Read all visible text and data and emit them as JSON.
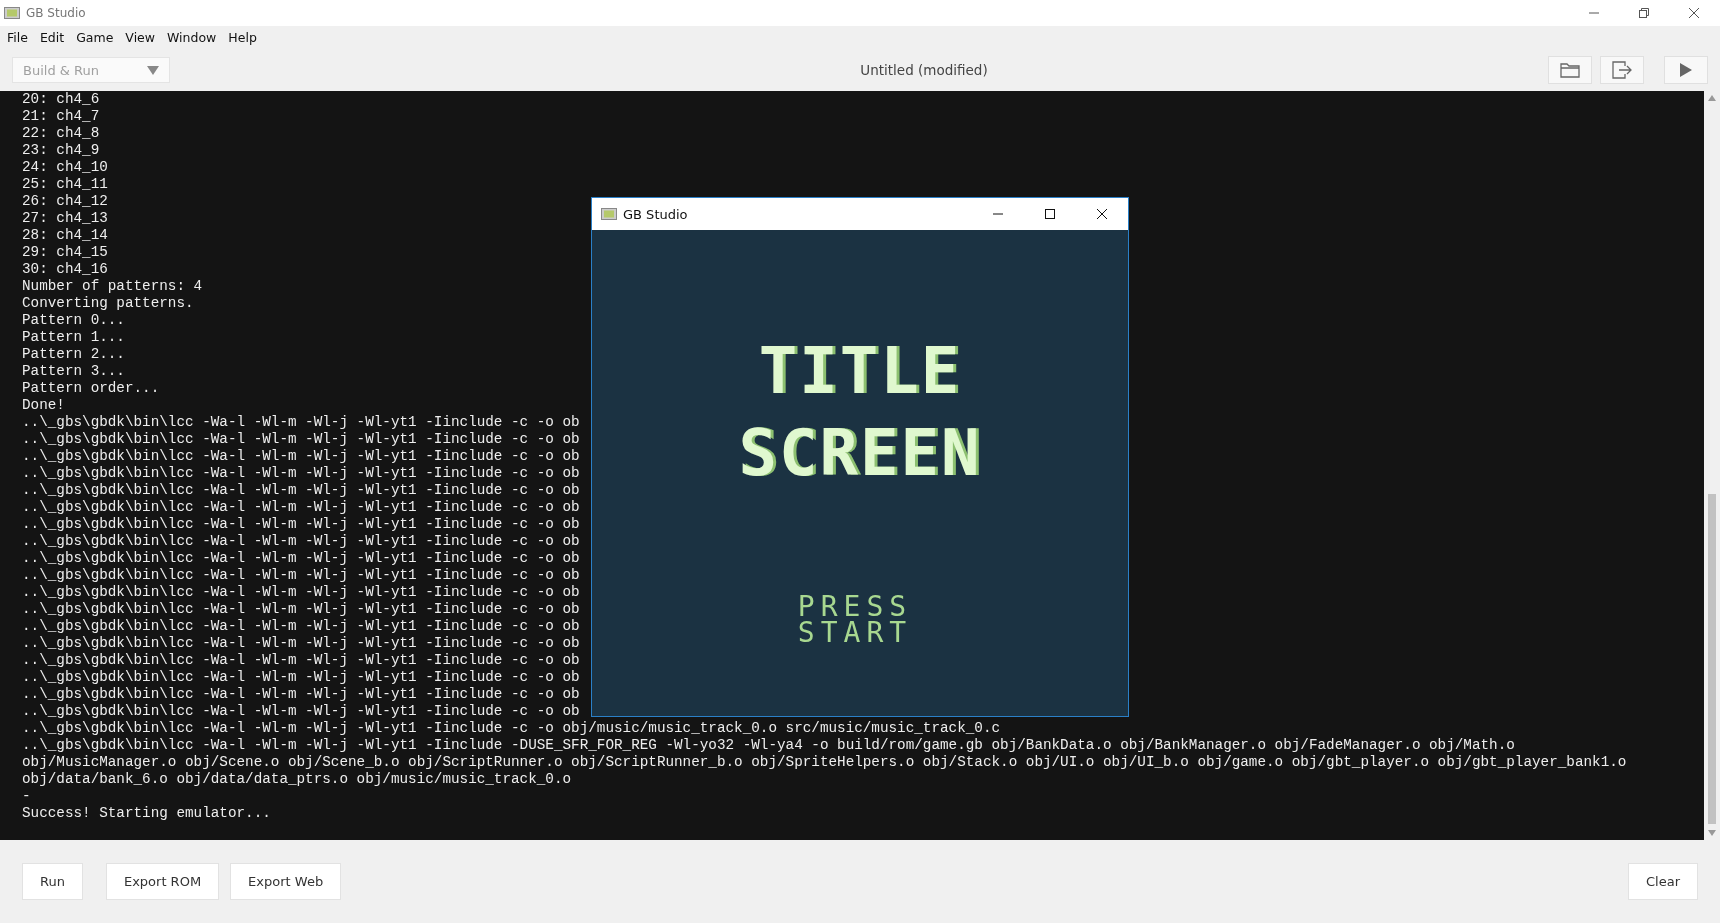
{
  "window": {
    "title": "GB Studio"
  },
  "menu": [
    "File",
    "Edit",
    "Game",
    "View",
    "Window",
    "Help"
  ],
  "toolbar": {
    "build_dropdown": {
      "label": "Build & Run",
      "disabled": true
    },
    "project_title": "Untitled (modified)"
  },
  "console": {
    "lines": [
      "20: ch4_6",
      "21: ch4_7",
      "22: ch4_8",
      "23: ch4_9",
      "24: ch4_10",
      "25: ch4_11",
      "26: ch4_12",
      "27: ch4_13",
      "28: ch4_14",
      "29: ch4_15",
      "30: ch4_16",
      "Number of patterns: 4",
      "Converting patterns.",
      "Pattern 0...",
      "Pattern 1...",
      "Pattern 2...",
      "Pattern 3...",
      "Pattern order...",
      "Done!",
      "..\\_gbs\\gbdk\\bin\\lcc -Wa-l -Wl-m -Wl-j -Wl-yt1 -Iinclude -c -o ob",
      "..\\_gbs\\gbdk\\bin\\lcc -Wa-l -Wl-m -Wl-j -Wl-yt1 -Iinclude -c -o ob",
      "..\\_gbs\\gbdk\\bin\\lcc -Wa-l -Wl-m -Wl-j -Wl-yt1 -Iinclude -c -o ob",
      "..\\_gbs\\gbdk\\bin\\lcc -Wa-l -Wl-m -Wl-j -Wl-yt1 -Iinclude -c -o ob",
      "..\\_gbs\\gbdk\\bin\\lcc -Wa-l -Wl-m -Wl-j -Wl-yt1 -Iinclude -c -o ob",
      "..\\_gbs\\gbdk\\bin\\lcc -Wa-l -Wl-m -Wl-j -Wl-yt1 -Iinclude -c -o ob",
      "..\\_gbs\\gbdk\\bin\\lcc -Wa-l -Wl-m -Wl-j -Wl-yt1 -Iinclude -c -o ob",
      "..\\_gbs\\gbdk\\bin\\lcc -Wa-l -Wl-m -Wl-j -Wl-yt1 -Iinclude -c -o ob",
      "..\\_gbs\\gbdk\\bin\\lcc -Wa-l -Wl-m -Wl-j -Wl-yt1 -Iinclude -c -o ob",
      "..\\_gbs\\gbdk\\bin\\lcc -Wa-l -Wl-m -Wl-j -Wl-yt1 -Iinclude -c -o ob",
      "..\\_gbs\\gbdk\\bin\\lcc -Wa-l -Wl-m -Wl-j -Wl-yt1 -Iinclude -c -o ob",
      "..\\_gbs\\gbdk\\bin\\lcc -Wa-l -Wl-m -Wl-j -Wl-yt1 -Iinclude -c -o ob",
      "..\\_gbs\\gbdk\\bin\\lcc -Wa-l -Wl-m -Wl-j -Wl-yt1 -Iinclude -c -o ob",
      "..\\_gbs\\gbdk\\bin\\lcc -Wa-l -Wl-m -Wl-j -Wl-yt1 -Iinclude -c -o ob",
      "..\\_gbs\\gbdk\\bin\\lcc -Wa-l -Wl-m -Wl-j -Wl-yt1 -Iinclude -c -o ob",
      "..\\_gbs\\gbdk\\bin\\lcc -Wa-l -Wl-m -Wl-j -Wl-yt1 -Iinclude -c -o ob",
      "..\\_gbs\\gbdk\\bin\\lcc -Wa-l -Wl-m -Wl-j -Wl-yt1 -Iinclude -c -o ob",
      "..\\_gbs\\gbdk\\bin\\lcc -Wa-l -Wl-m -Wl-j -Wl-yt1 -Iinclude -c -o ob",
      "..\\_gbs\\gbdk\\bin\\lcc -Wa-l -Wl-m -Wl-j -Wl-yt1 -Iinclude -c -o obj/music/music_track_0.o src/music/music_track_0.c",
      "..\\_gbs\\gbdk\\bin\\lcc -Wa-l -Wl-m -Wl-j -Wl-yt1 -Iinclude -DUSE_SFR_FOR_REG -Wl-yo32 -Wl-ya4 -o build/rom/game.gb obj/BankData.o obj/BankManager.o obj/FadeManager.o obj/Math.o",
      "obj/MusicManager.o obj/Scene.o obj/Scene_b.o obj/ScriptRunner.o obj/ScriptRunner_b.o obj/SpriteHelpers.o obj/Stack.o obj/UI.o obj/UI_b.o obj/game.o obj/gbt_player.o obj/gbt_player_bank1.o",
      "obj/data/bank_6.o obj/data/data_ptrs.o obj/music/music_track_0.o",
      "-",
      "Success! Starting emulator..."
    ]
  },
  "emulator": {
    "title": "GB Studio",
    "title_lines": [
      "TITLE",
      "SCREEN"
    ],
    "prompt_lines": [
      "PRESS",
      "START"
    ]
  },
  "actions": [
    "Run",
    "Export ROM",
    "Export Web"
  ],
  "clear_button": "Clear"
}
